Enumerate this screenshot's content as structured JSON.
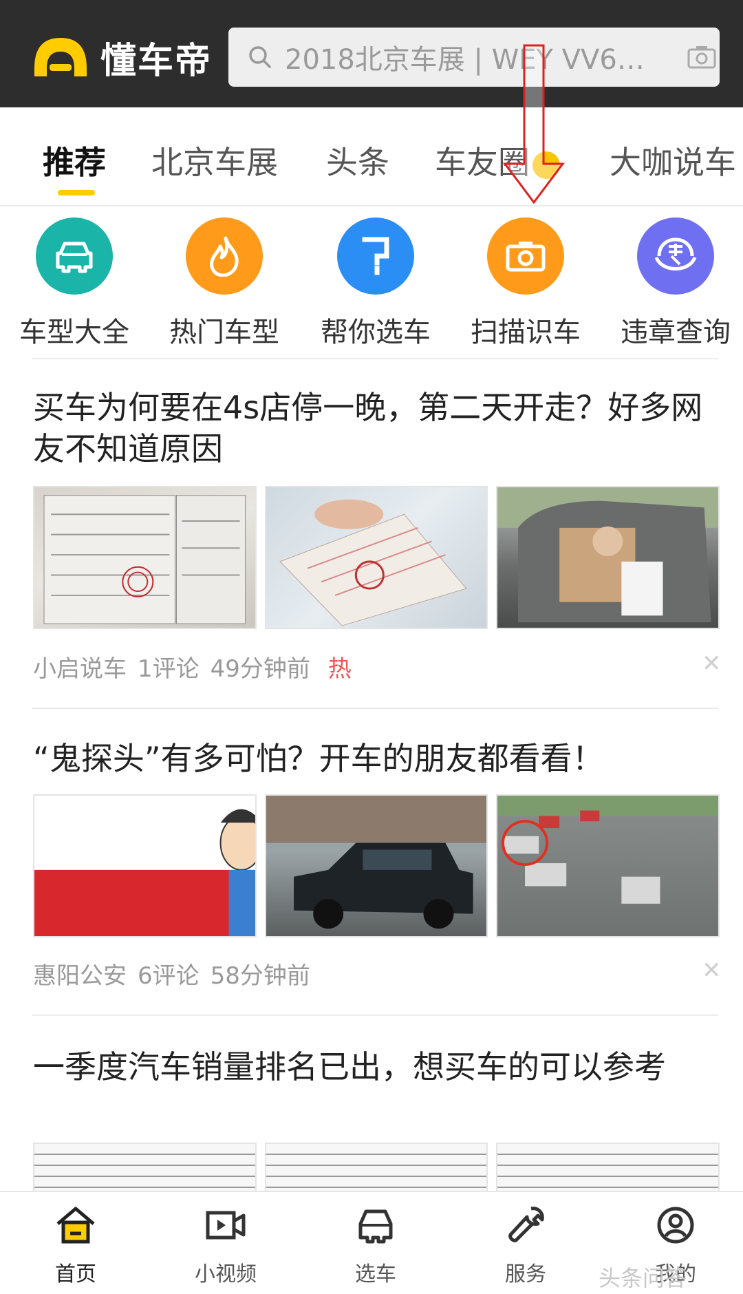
{
  "header": {
    "app_name": "懂车帝",
    "search_placeholder": "2018北京车展 | WEY VV6…",
    "accent_color": "#ffcc00"
  },
  "tabs": [
    {
      "label": "推荐",
      "active": true
    },
    {
      "label": "北京车展"
    },
    {
      "label": "头条"
    },
    {
      "label": "车友圈"
    },
    {
      "label": "大咖说车"
    }
  ],
  "quick_entries": [
    {
      "label": "车型大全",
      "icon": "car-icon",
      "color": "#1ab5a8"
    },
    {
      "label": "热门车型",
      "icon": "flame-icon",
      "color": "#ff9a1a"
    },
    {
      "label": "帮你选车",
      "icon": "question-icon",
      "color": "#2b8ef5"
    },
    {
      "label": "扫描识车",
      "icon": "camera-icon",
      "color": "#ff9a1a"
    },
    {
      "label": "违章查询",
      "icon": "traffic-police-icon",
      "color": "#6f6ff2"
    }
  ],
  "articles": [
    {
      "title": "买车为何要在4s店停一晚，第二天开走？好多网友不知道原因",
      "source": "小启说车",
      "comments": "1评论",
      "time": "49分钟前",
      "tag": "热"
    },
    {
      "title": "“鬼探头”有多可怕？开车的朋友都看看！",
      "source": "惠阳公安",
      "comments": "6评论",
      "time": "58分钟前"
    },
    {
      "title": "一季度汽车销量排名已出，想买车的可以参考"
    }
  ],
  "bottom_nav": [
    {
      "label": "首页",
      "icon": "home-icon",
      "active": true
    },
    {
      "label": "小视频",
      "icon": "video-icon"
    },
    {
      "label": "选车",
      "icon": "car-icon"
    },
    {
      "label": "服务",
      "icon": "wrench-icon"
    },
    {
      "label": "我的",
      "icon": "profile-icon"
    }
  ],
  "watermark": "头条问答"
}
